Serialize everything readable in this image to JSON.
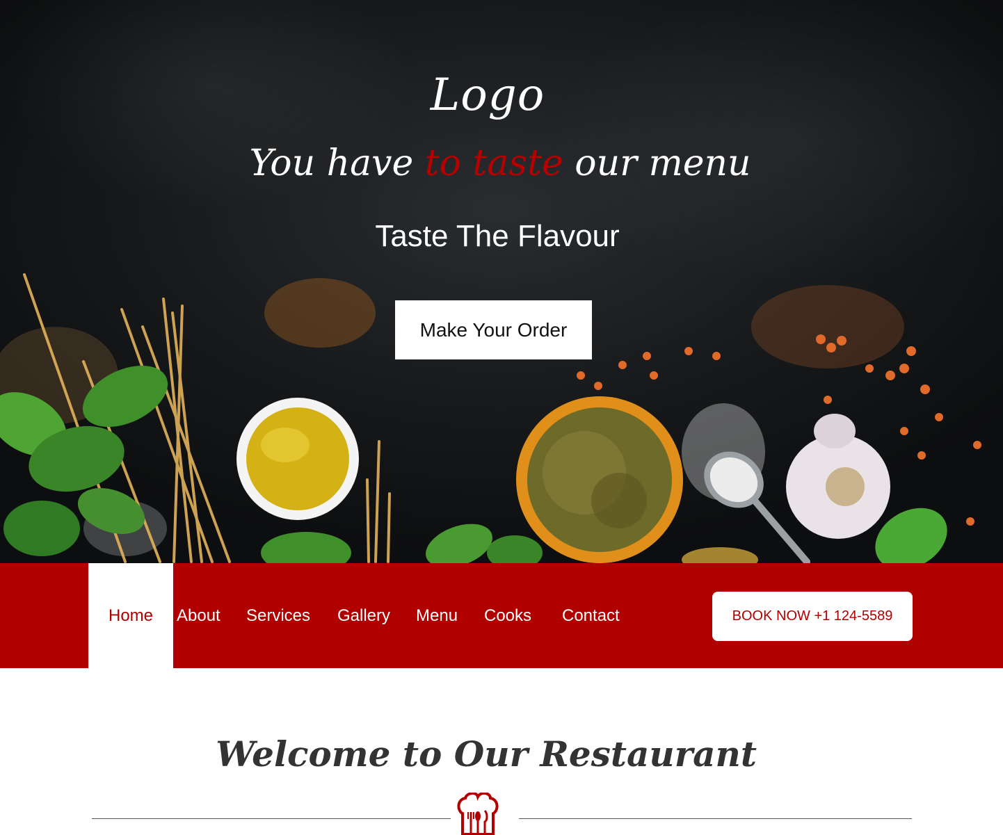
{
  "hero": {
    "logo": "Logo",
    "tagline_before": "You have ",
    "tagline_accent": "to taste",
    "tagline_after": " our menu",
    "subtitle": "Taste The Flavour",
    "cta_label": "Make Your Order"
  },
  "nav": {
    "items": [
      {
        "label": "Home",
        "active": true
      },
      {
        "label": "About"
      },
      {
        "label": "Services"
      },
      {
        "label": "Gallery"
      },
      {
        "label": "Menu"
      },
      {
        "label": "Cooks"
      },
      {
        "label": "Contact"
      }
    ],
    "book_label": "BOOK NOW +1 124-5589"
  },
  "welcome": {
    "title": "Welcome to Our Restaurant",
    "icon": "chef-hat-cutlery-icon"
  },
  "colors": {
    "brand_red": "#b10000",
    "hero_dark": "#16181a",
    "white": "#ffffff"
  }
}
